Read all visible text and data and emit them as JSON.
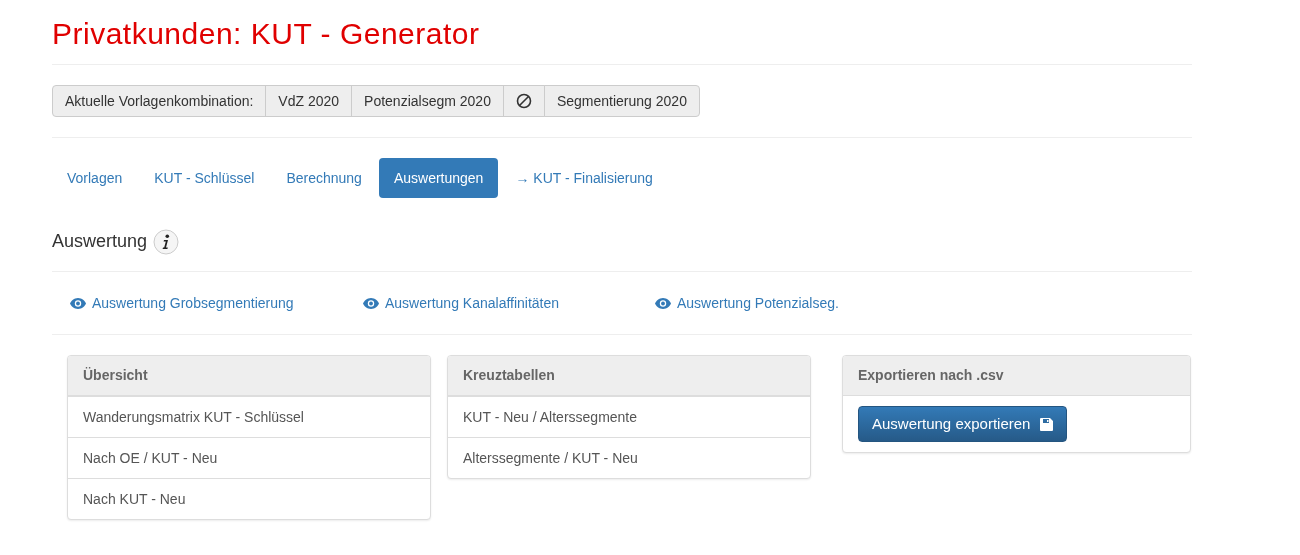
{
  "title": "Privatkunden: KUT - Generator",
  "template_bar": [
    {
      "kind": "label",
      "text": "Aktuelle Vorlagenkombination:"
    },
    {
      "kind": "value",
      "text": "VdZ 2020"
    },
    {
      "kind": "value",
      "text": "Potenzialsegm 2020"
    },
    {
      "kind": "none"
    },
    {
      "kind": "value",
      "text": "Segmentierung 2020"
    }
  ],
  "tabs": [
    {
      "label": "Vorlagen",
      "selected": false
    },
    {
      "label": "KUT - Schlüssel",
      "selected": false
    },
    {
      "label": "Berechnung",
      "selected": false
    },
    {
      "label": "Auswertungen",
      "selected": true
    },
    {
      "label": "→ KUT - Finalisierung",
      "selected": false
    }
  ],
  "section_title": "Auswertung",
  "view_links": [
    "Auswertung Grobsegmentierung",
    "Auswertung Kanalaffinitäten",
    "Auswertung Potenzialseg."
  ],
  "panels": [
    {
      "kind": "list",
      "title": "Übersicht",
      "items": [
        "Wanderungsmatrix KUT - Schlüssel",
        "Nach OE / KUT - Neu",
        "Nach KUT - Neu"
      ]
    },
    {
      "kind": "list",
      "title": "Kreuztabellen",
      "items": [
        "KUT - Neu / Alterssegmente",
        "Alterssegmente / KUT - Neu"
      ]
    },
    {
      "kind": "export",
      "title": "Exportieren nach .csv",
      "button": "Auswertung exportieren"
    }
  ]
}
